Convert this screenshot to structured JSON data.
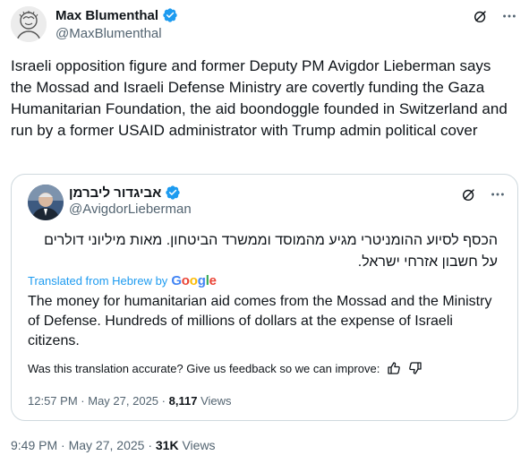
{
  "tweet": {
    "author_name": "Max Blumenthal",
    "author_handle": "@MaxBlumenthal",
    "text": "Israeli opposition figure and former Deputy PM Avigdor Lieberman says the Mossad and Israeli Defense Ministry are covertly funding the Gaza Humanitarian Foundation, the aid boondoggle founded in Switzerland and run by a former USAID administrator with Trump admin political cover",
    "time": "9:49 PM",
    "separator": "·",
    "date": "May 27, 2025",
    "views_count": "31K",
    "views_label": "Views",
    "icons": [
      "grok-icon",
      "more-icon",
      "verified-icon"
    ]
  },
  "quote": {
    "author_name": "אביגדור ליברמן",
    "author_handle": "@AvigdorLieberman",
    "hebrew_text": "הכסף לסיוע ההומניטרי מגיע מהמוסד וממשרד הביטחון. מאות מיליוני דולרים על חשבון אזרחי ישראל.",
    "translated_prefix": "Translated from Hebrew by",
    "translated_google": [
      "G",
      "o",
      "o",
      "g",
      "l",
      "e"
    ],
    "translation": "The money for humanitarian aid comes from the Mossad and the Ministry of Defense. Hundreds of millions of dollars at the expense of Israeli citizens.",
    "feedback_text": "Was this translation accurate? Give us feedback so we can improve:",
    "time": "12:57 PM",
    "separator": "·",
    "date": "May 27, 2025",
    "views_count": "8,117",
    "views_label": "Views"
  },
  "colors": {
    "accent": "#1d9bf0",
    "secondary_text": "#536471",
    "border": "#cfd9de"
  }
}
